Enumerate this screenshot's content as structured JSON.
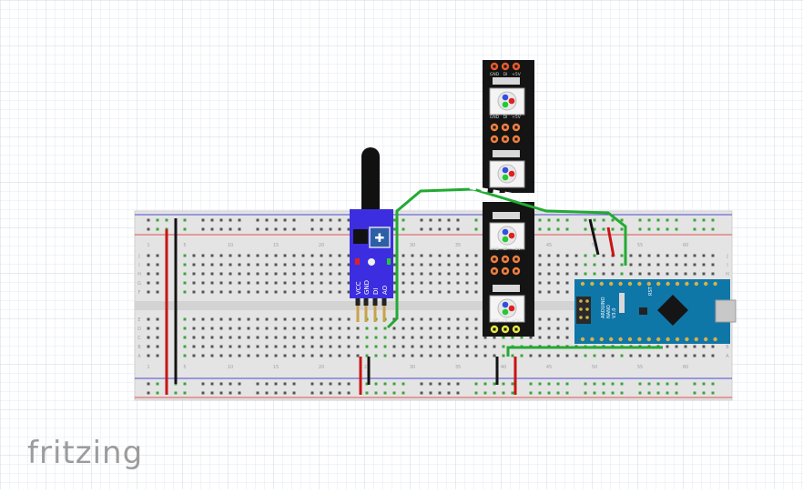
{
  "watermark": "fritzing",
  "sensor_module": {
    "pins": [
      "VCC",
      "GND",
      "DI",
      "AO"
    ],
    "colors": {
      "board": "#3c2ee0",
      "header": "#c9a24a"
    }
  },
  "led_strip": {
    "pads": [
      "GND",
      "DI",
      "+5V"
    ],
    "colors": {
      "strip": "#141414",
      "pad_top": "#e85a2a",
      "pad_mid": "#f08040",
      "pad_bottom": "#e8e84a"
    }
  },
  "arduino": {
    "labels": [
      "RST",
      "ARDUINO",
      "NANO",
      "V3.0"
    ],
    "colors": {
      "board": "#0f76a8"
    }
  },
  "breadboard": {
    "column_numbers": [
      "1",
      "5",
      "10",
      "15",
      "20",
      "25",
      "30",
      "35",
      "40",
      "45",
      "50",
      "55",
      "60"
    ],
    "row_letters": [
      "A",
      "B",
      "C",
      "D",
      "E",
      "F",
      "G",
      "H",
      "I",
      "J"
    ],
    "colors": {
      "body": "#e4e4e4",
      "hole": "#555555",
      "active_hole": "#3aa53a",
      "rail_red": "#e05050",
      "rail_blue": "#4a4ad8"
    }
  },
  "wires": {
    "colors": {
      "red": "#c81414",
      "black": "#141414",
      "green": "#22aa33"
    }
  }
}
